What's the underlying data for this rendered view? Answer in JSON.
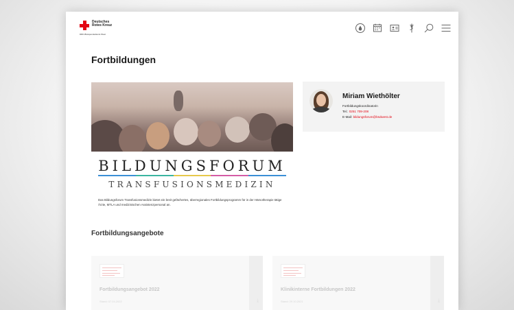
{
  "logo": {
    "name_lines": "Deutsches Rotes Kreuz",
    "subline": "DRK-Blutspendedienst West"
  },
  "header": {
    "icons": [
      "blood-drop-icon",
      "calendar-icon",
      "id-card-icon",
      "caduceus-icon",
      "search-icon",
      "menu-icon"
    ]
  },
  "page": {
    "title": "Fortbildungen"
  },
  "hero": {
    "brand_line1": "BILDUNGSFORUM",
    "brand_line2": "TRANSFUSIONSMEDIZIN",
    "stripe_colors": [
      "#3a8fd6",
      "#3ab5a0",
      "#e6c84a",
      "#d45ba6",
      "#3a8fd6"
    ],
    "description": "Das Bildungsforum Transfusionsmedizin bietet ein breit gefächertes, überregionales Fortbildungsprogramm für in der Hämotherapie tätige Ärzte, MTLA und medizinischen Assistenzpersonal an."
  },
  "contact": {
    "name": "Miriam Wiethölter",
    "role": "Fortbildungskoordinatorin",
    "tel_label": "Tel.: ",
    "tel_value": "0251 709-208",
    "mail_label": "E-Mail: ",
    "mail_value": "bildungsforum@bsdwest.de"
  },
  "offers": {
    "title": "Fortbildungsangebote",
    "cards": [
      {
        "title": "Fortbildungsangebot 2022",
        "date": "Stand: 07.04.2022"
      },
      {
        "title": "Klinikinterne Fortbildungen 2022",
        "date": "Stand: 29.10.2021"
      }
    ]
  },
  "colors": {
    "brand_red": "#e30613"
  }
}
